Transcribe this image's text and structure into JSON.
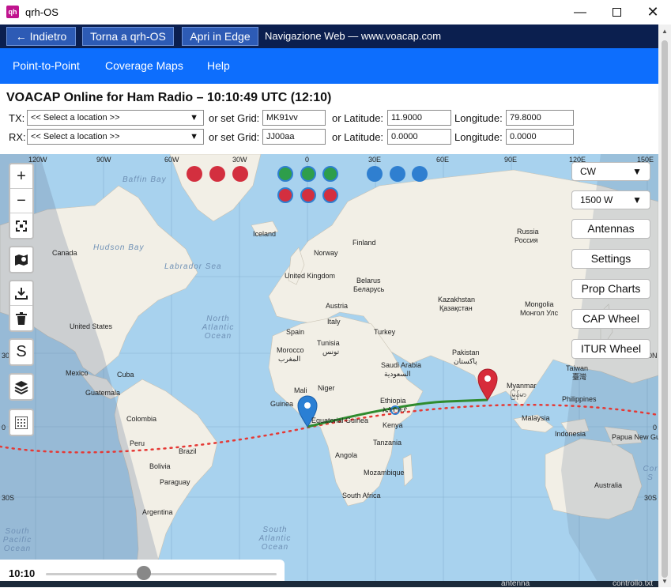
{
  "window": {
    "title": "qrh-OS",
    "app_icon": "qrh-app-icon",
    "controls": [
      "minimize-icon",
      "maximize-icon",
      "close-icon"
    ]
  },
  "nav": {
    "back_label": "← Indietro",
    "home_label": "Torna a qrh-OS",
    "edge_label": "Apri in Edge",
    "status": "Navigazione Web — www.voacap.com"
  },
  "menu": {
    "items": [
      "Point-to-Point",
      "Coverage Maps",
      "Help"
    ]
  },
  "page": {
    "title": "VOACAP Online for Ham Radio – 10:10:49 UTC (12:10)"
  },
  "tx": {
    "label": "TX:",
    "location": "<< Select a location >>",
    "grid_label": "or set Grid:",
    "grid": "MK91vv",
    "lat_label": "or Latitude:",
    "lat": "11.9000",
    "lon_label": "Longitude:",
    "lon": "79.8000"
  },
  "rx": {
    "label": "RX:",
    "location": "<< Select a location >>",
    "grid_label": "or set Grid:",
    "grid": "JJ00aa",
    "lat_label": "or Latitude:",
    "lat": "0.0000",
    "lon_label": "Longitude:",
    "lon": "0.0000"
  },
  "map_controls": {
    "zoom_in": "+",
    "zoom_out": "−",
    "s_label": "S"
  },
  "right_panel": {
    "mode": "CW",
    "power": "1500 W",
    "buttons": [
      "Antennas",
      "Settings",
      "Prop Charts",
      "CAP Wheel",
      "ITUR Wheel"
    ]
  },
  "colors": {
    "red_dot": "#d32f3f",
    "green_dot": "#2e9e4b",
    "blue_dot": "#2f7fd0",
    "path": "#2e8b2e",
    "dotted_line": "#e53935",
    "tx_pin": "#d72b3a",
    "rx_pin": "#2a7fd4"
  },
  "axis": {
    "top": [
      "120W",
      "90W",
      "60W",
      "30W",
      "0",
      "30E",
      "60E",
      "90E",
      "120E",
      "150E"
    ],
    "left": [
      "30N",
      "0",
      "30S"
    ],
    "right": [
      "30N",
      "0",
      "30S"
    ]
  },
  "timeline": {
    "time": "10:10",
    "position": 0.425
  },
  "taskbar": {
    "items": [
      "antenna",
      "controllo.txt"
    ]
  },
  "map_labels": {
    "land": [
      "Baffin Bay",
      "Canada",
      "Hudson Bay",
      "Labrador Sea",
      "Iceland",
      "Norway",
      "Finland",
      "Russia",
      "Россия",
      "United Kingdom",
      "Belarus",
      "Беларусь",
      "Kazakhstan",
      "Қазақстан",
      "Mongolia",
      "Монгол Улс",
      "Austria",
      "Italy",
      "Spain",
      "Turkey",
      "Tunisia",
      "تونس",
      "Morocco",
      "المغرب",
      "Pakistan",
      "پاکستان",
      "Saudi Arabia",
      "السعودية",
      "Taiwan",
      "臺灣",
      "Mali",
      "Niger",
      "Ethiopia",
      "ኢትዮጵያ",
      "Myanmar",
      "မြန်မာ",
      "Philippines",
      "Malaysia",
      "Guinea",
      "Equatorial Guinea",
      "Kenya",
      "Indonesia",
      "Papua New Guinea",
      "Tanzania",
      "Angola",
      "Mozambique",
      "South Africa",
      "Australia",
      "United States",
      "Mexico",
      "Cuba",
      "Guatemala",
      "Colombia",
      "Peru",
      "Brazil",
      "Bolivia",
      "Paraguay",
      "Argentina"
    ],
    "ocean": [
      "North Atlantic Ocean",
      "South Atlantic Ocean",
      "South Pacific Ocean",
      "Cor S"
    ]
  }
}
